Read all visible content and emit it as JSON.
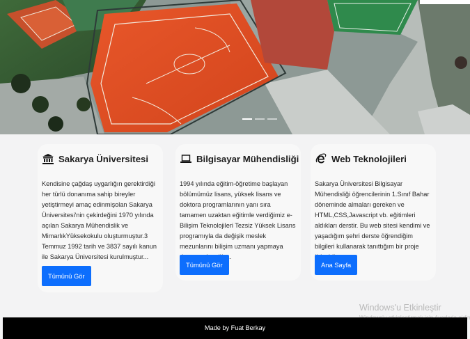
{
  "hero": {
    "image": "aerial-sports-courts"
  },
  "cards": [
    {
      "title": "Sakarya Üniversitesi",
      "icon": "bank-icon",
      "text": "Kendisine çağdaş uygarlığın gerektirdiği her türlü donanıma sahip bireyler yetiştirmeyi amaç edinmişolan Sakarya Üniversitesi'nin çekirdeğini 1970 yılında açılan Sakarya Mühendislik ve MimarlıkYüksekokulu oluşturmuştur.3 Temmuz 1992 tarih ve 3837 sayılı kanun ile Sakarya Üniversitesi kurulmuştur...",
      "button": "Tümünü Gör"
    },
    {
      "title": "Bilgisayar Mühendisliği",
      "icon": "laptop-icon",
      "text": "1994 yılında eğitim-öğretime başlayan bölümümüz lisans, yüksek lisans ve doktora programlarının yanı sıra tamamen uzaktan eğitimle verdiğimiz e-Bilişim Teknolojileri Tezsiz Yüksek Lisans programıyla da değişik meslek mezunlarını bilişim uzmanı yapmaya devam edeceğiz...",
      "button": "Tümünü Gör"
    },
    {
      "title": "Web Teknolojileri",
      "icon": "internet-explorer-icon",
      "text": "Sakarya Üniversitesi Bilgisayar Mühendisliği öğrencilerinin 1.Sınıf Bahar döneminde almaları gereken ve HTML,CSS,Javascript vb. eğitimleri aldıkları derstir. Bu web sitesi kendimi ve yaşadığım şehri derste öğrendiğim bilgileri kullanarak tanıttığım bir proje ödevidir.",
      "button": "Ana Sayfa"
    }
  ],
  "watermark": {
    "title": "Windows'u Etkinleştir",
    "subtitle": "Windows'u etkinleştirmek için Ayarlar'a gidin."
  },
  "footer": {
    "text": "Made by Fuat Berkay"
  }
}
